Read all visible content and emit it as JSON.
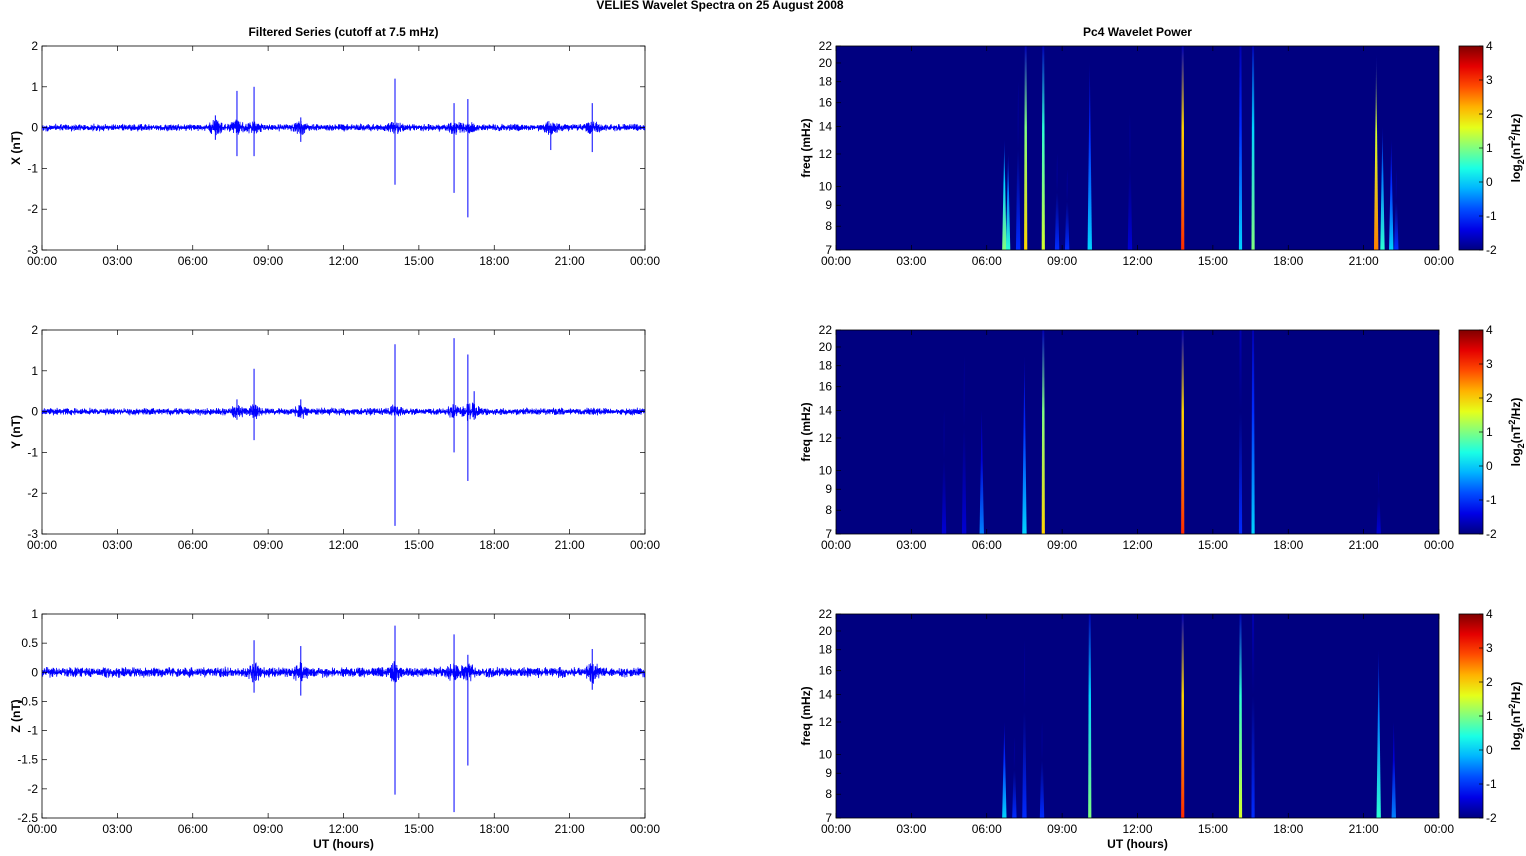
{
  "title": "VELIES Wavelet Spectra on 25 August    2008",
  "chart_data": [
    {
      "type": "line",
      "panel": "X",
      "title": "Filtered Series (cutoff at 7.5 mHz)",
      "ylabel": "X (nT)",
      "xlabel": "",
      "xlim": [
        0,
        24
      ],
      "ylim": [
        -3,
        2
      ],
      "yticks": [
        "2",
        "1",
        "0",
        "-1",
        "-2",
        "-3"
      ],
      "xticks": [
        "00:00",
        "03:00",
        "06:00",
        "09:00",
        "12:00",
        "15:00",
        "18:00",
        "21:00",
        "00:00"
      ],
      "color": "#0000ff",
      "noise_amplitude": 0.1,
      "spikes": [
        [
          6.9,
          0.3,
          -0.3
        ],
        [
          7.76,
          0.9,
          -0.7
        ],
        [
          8.44,
          1.0,
          -0.7
        ],
        [
          10.3,
          0.25,
          -0.35
        ],
        [
          14.05,
          1.2,
          -1.4
        ],
        [
          16.4,
          0.6,
          -1.6
        ],
        [
          16.95,
          0.7,
          -2.2
        ],
        [
          20.25,
          0.1,
          -0.55
        ],
        [
          21.9,
          0.6,
          -0.6
        ]
      ]
    },
    {
      "type": "line",
      "panel": "Y",
      "title": "",
      "ylabel": "Y (nT)",
      "xlabel": "",
      "xlim": [
        0,
        24
      ],
      "ylim": [
        -3,
        2
      ],
      "yticks": [
        "2",
        "1",
        "0",
        "-1",
        "-2",
        "-3"
      ],
      "xticks": [
        "00:00",
        "03:00",
        "06:00",
        "09:00",
        "12:00",
        "15:00",
        "18:00",
        "21:00",
        "00:00"
      ],
      "color": "#0000ff",
      "noise_amplitude": 0.1,
      "spikes": [
        [
          7.76,
          0.3,
          -0.2
        ],
        [
          8.44,
          1.05,
          -0.7
        ],
        [
          10.3,
          0.3,
          -0.15
        ],
        [
          14.05,
          1.65,
          -2.8
        ],
        [
          16.4,
          1.8,
          -1.0
        ],
        [
          16.95,
          1.4,
          -1.7
        ],
        [
          17.2,
          0.5,
          -0.2
        ]
      ]
    },
    {
      "type": "line",
      "panel": "Z",
      "title": "",
      "ylabel": "Z (nT)",
      "xlabel": "UT (hours)",
      "xlim": [
        0,
        24
      ],
      "ylim": [
        -2.5,
        1
      ],
      "yticks": [
        "1",
        "0.5",
        "0",
        "-0.5",
        "-1",
        "-1.5",
        "-2",
        "-2.5"
      ],
      "xticks": [
        "00:00",
        "03:00",
        "06:00",
        "09:00",
        "12:00",
        "15:00",
        "18:00",
        "21:00",
        "00:00"
      ],
      "color": "#0000ff",
      "noise_amplitude": 0.1,
      "spikes": [
        [
          8.44,
          0.55,
          -0.35
        ],
        [
          10.3,
          0.45,
          -0.4
        ],
        [
          14.05,
          0.8,
          -2.1
        ],
        [
          16.4,
          0.65,
          -2.4
        ],
        [
          16.95,
          0.3,
          -1.6
        ],
        [
          21.9,
          0.4,
          -0.3
        ]
      ]
    },
    {
      "type": "heatmap",
      "panel": "X",
      "title": "Pc4 Wavelet Power",
      "ylabel": "freq (mHz)",
      "xlabel": "",
      "xlim": [
        0,
        24
      ],
      "ylim": [
        7,
        22
      ],
      "yscale": "log",
      "yticks": [
        "7",
        "8",
        "9",
        "10",
        "12",
        "14",
        "16",
        "18",
        "20",
        "22"
      ],
      "xticks": [
        "00:00",
        "03:00",
        "06:00",
        "09:00",
        "12:00",
        "15:00",
        "18:00",
        "21:00",
        "00:00"
      ],
      "clim": [
        -2,
        4
      ],
      "cticks": [
        "4",
        "3",
        "2",
        "1",
        "0",
        "-1",
        "-2"
      ],
      "clabel": {
        "base": "log",
        "sub": "2",
        "mid": "(nT",
        "sup": "2",
        "end": "/Hz)"
      },
      "streaks": [
        [
          6.7,
          13,
          1
        ],
        [
          6.85,
          12,
          0.5
        ],
        [
          7.25,
          18,
          -1
        ],
        [
          7.55,
          22,
          2
        ],
        [
          8.25,
          22,
          1.5
        ],
        [
          8.8,
          12,
          -1
        ],
        [
          9.2,
          11,
          -1
        ],
        [
          10.1,
          20,
          0
        ],
        [
          11.7,
          15,
          -1.5
        ],
        [
          13.8,
          22,
          3
        ],
        [
          16.1,
          22,
          0
        ],
        [
          16.6,
          22,
          1
        ],
        [
          21.5,
          21,
          2.5
        ],
        [
          21.75,
          14,
          0.5
        ],
        [
          22.1,
          13,
          0
        ],
        [
          22.3,
          11,
          -1
        ]
      ]
    },
    {
      "type": "heatmap",
      "panel": "Y",
      "title": "",
      "ylabel": "freq (mHz)",
      "xlabel": "",
      "xlim": [
        0,
        24
      ],
      "ylim": [
        7,
        22
      ],
      "yscale": "log",
      "yticks": [
        "7",
        "8",
        "9",
        "10",
        "12",
        "14",
        "16",
        "18",
        "20",
        "22"
      ],
      "xticks": [
        "00:00",
        "03:00",
        "06:00",
        "09:00",
        "12:00",
        "15:00",
        "18:00",
        "21:00",
        "00:00"
      ],
      "clim": [
        -2,
        4
      ],
      "cticks": [
        "4",
        "3",
        "2",
        "1",
        "0",
        "-1",
        "-2"
      ],
      "clabel": {
        "base": "log",
        "sub": "2",
        "mid": "(nT",
        "sup": "2",
        "end": "/Hz)"
      },
      "streaks": [
        [
          4.3,
          14,
          -1.5
        ],
        [
          5.1,
          19,
          -1.5
        ],
        [
          5.8,
          14,
          -0.5
        ],
        [
          7.5,
          19,
          0
        ],
        [
          8.25,
          22,
          2
        ],
        [
          13.8,
          22,
          3
        ],
        [
          16.1,
          22,
          -1
        ],
        [
          16.6,
          22,
          0
        ],
        [
          21.6,
          10,
          -1.5
        ]
      ]
    },
    {
      "type": "heatmap",
      "panel": "Z",
      "title": "",
      "ylabel": "freq (mHz)",
      "xlabel": "UT (hours)",
      "xlim": [
        0,
        24
      ],
      "ylim": [
        7,
        22
      ],
      "yscale": "log",
      "yticks": [
        "7",
        "8",
        "9",
        "10",
        "12",
        "14",
        "16",
        "18",
        "20",
        "22"
      ],
      "xticks": [
        "00:00",
        "03:00",
        "06:00",
        "09:00",
        "12:00",
        "15:00",
        "18:00",
        "21:00",
        "00:00"
      ],
      "clim": [
        -2,
        4
      ],
      "cticks": [
        "4",
        "3",
        "2",
        "1",
        "0",
        "-1",
        "-2"
      ],
      "clabel": {
        "base": "log",
        "sub": "2",
        "mid": "(nT",
        "sup": "2",
        "end": "/Hz)"
      },
      "streaks": [
        [
          6.7,
          12,
          0
        ],
        [
          7.1,
          11,
          -1
        ],
        [
          7.5,
          19,
          -1
        ],
        [
          8.2,
          12,
          -1
        ],
        [
          10.1,
          22,
          1
        ],
        [
          13.8,
          22,
          3
        ],
        [
          16.1,
          22,
          1.5
        ],
        [
          16.6,
          22,
          -1
        ],
        [
          21.6,
          18,
          0.5
        ],
        [
          22.2,
          12,
          -0.5
        ]
      ]
    }
  ]
}
